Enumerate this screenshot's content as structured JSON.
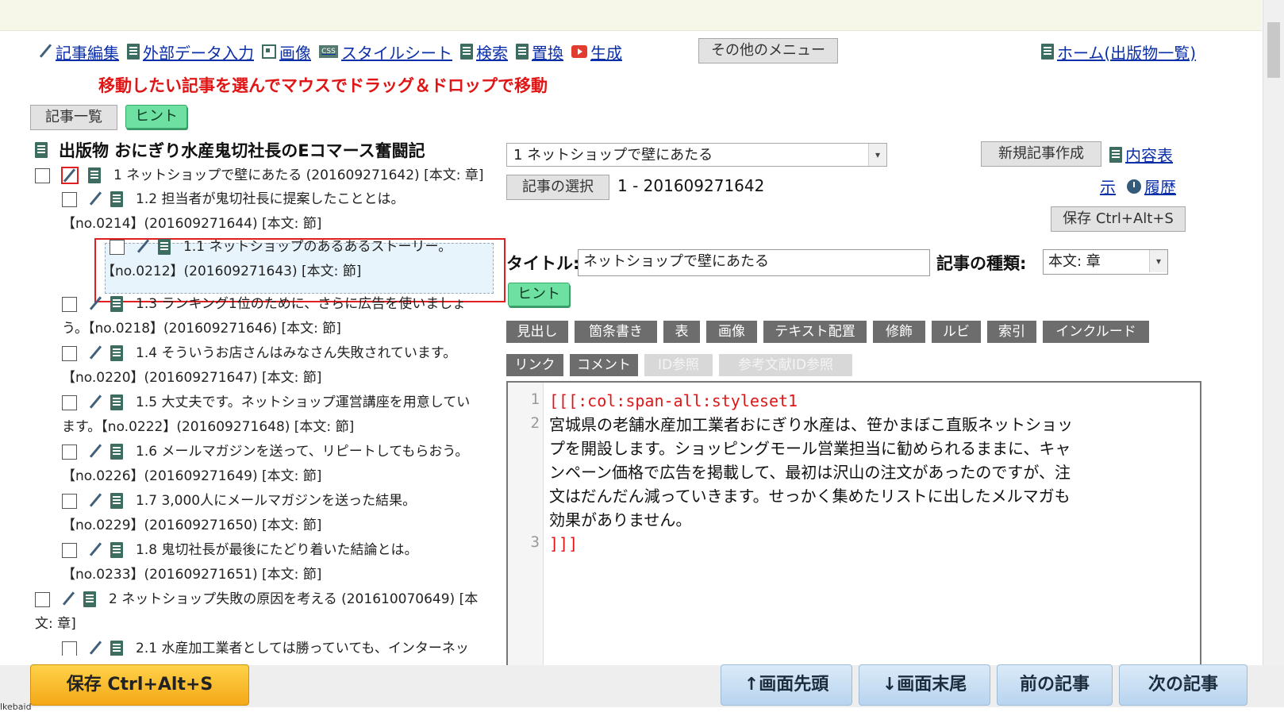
{
  "toolbar": {
    "items": [
      {
        "label": "記事編集"
      },
      {
        "label": "外部データ入力"
      },
      {
        "label": "画像"
      },
      {
        "label": "スタイルシート"
      },
      {
        "label": "検索"
      },
      {
        "label": "置換"
      },
      {
        "label": "生成"
      }
    ],
    "other_menu": "その他のメニュー",
    "home": "ホーム(出版物一覧)",
    "css_icon_text": "CSS"
  },
  "notice": "移動したい記事を選んでマウスでドラッグ＆ドロップで移動",
  "left": {
    "article_list_btn": "記事一覧",
    "hint_btn": "ヒント",
    "publication_title": "出版物 おにぎり水産鬼切社長のEコマース奮闘記",
    "nodes": [
      {
        "line1": "1 ネットショップで壁にあたる (201609271642) [本文: 章]",
        "line2": ""
      },
      {
        "line1": "1.2 担当者が鬼切社長に提案したこととは。",
        "line2": "【no.0214】(201609271644) [本文: 節]"
      },
      {
        "line1": "1.1 ネットショップのあるあるストーリー。",
        "line2": "【no.0212】(201609271643) [本文: 節]"
      },
      {
        "line1": "1.3 ランキング1位のために、さらに広告を使いましょ",
        "line2": "う。【no.0218】(201609271646) [本文: 節]"
      },
      {
        "line1": "1.4 そういうお店さんはみなさん失敗されています。",
        "line2": "【no.0220】(201609271647) [本文: 節]"
      },
      {
        "line1": "1.5 大丈夫です。ネットショップ運営講座を用意してい",
        "line2": "ます。【no.0222】(201609271648) [本文: 節]"
      },
      {
        "line1": "1.6 メールマガジンを送って、リピートしてもらおう。",
        "line2": "【no.0226】(201609271649) [本文: 節]"
      },
      {
        "line1": "1.7 3,000人にメールマガジンを送った結果。",
        "line2": "【no.0229】(201609271650) [本文: 節]"
      },
      {
        "line1": "1.8 鬼切社長が最後にたどり着いた結論とは。",
        "line2": "【no.0233】(201609271651) [本文: 節]"
      },
      {
        "line1": "2 ネットショップ失敗の原因を考える (201610070649) [本",
        "line2": "文: 章]"
      },
      {
        "line1": "2.1 水産加工業者としては勝っていても、インターネッ",
        "line2": ""
      }
    ]
  },
  "right": {
    "article_select": "1 ネットショップで壁にあたる",
    "new_article": "新規記事作成",
    "toc_link": "内容表",
    "toc_link2": "示",
    "history_link": "履歴",
    "select_article_btn": "記事の選択",
    "article_id": "1 - 201609271642",
    "save_btn": "保存 Ctrl+Alt+S",
    "title_label": "タイトル:",
    "title_value": "ネットショップで壁にあたる",
    "type_label": "記事の種類:",
    "type_value": "本文: 章",
    "hint_btn": "ヒント",
    "format_row1": [
      "見出し",
      "箇条書き",
      "表",
      "画像",
      "テキスト配置",
      "修飾",
      "ルビ",
      "索引",
      "インクルード"
    ],
    "format_row2": [
      "リンク",
      "コメント",
      "ID参照",
      "参考文献ID参照"
    ]
  },
  "editor": {
    "line_numbers": [
      "1",
      "2",
      "3"
    ],
    "line1": "[[[:col:span-all:styleset1",
    "line2a": "宮城県の老舗水産加工業者おにぎり水産は、笹かまぼこ直販ネットショッ",
    "line2b": "プを開設します。ショッピングモール営業担当に勧められるままに、キャ",
    "line2c": "ンペーン価格で広告を掲載して、最初は沢山の注文があったのですが、注",
    "line2d": "文はだんだん減っていきます。せっかく集めたリストに出したメルマガも",
    "line2e": "効果がありません。",
    "line3": "]]]"
  },
  "bottom": {
    "save": "保存 Ctrl+Alt+S",
    "top": "↑画面先頭",
    "end": "↓画面末尾",
    "prev": "前の記事",
    "next": "次の記事",
    "status_fragment": "lkebaid"
  }
}
